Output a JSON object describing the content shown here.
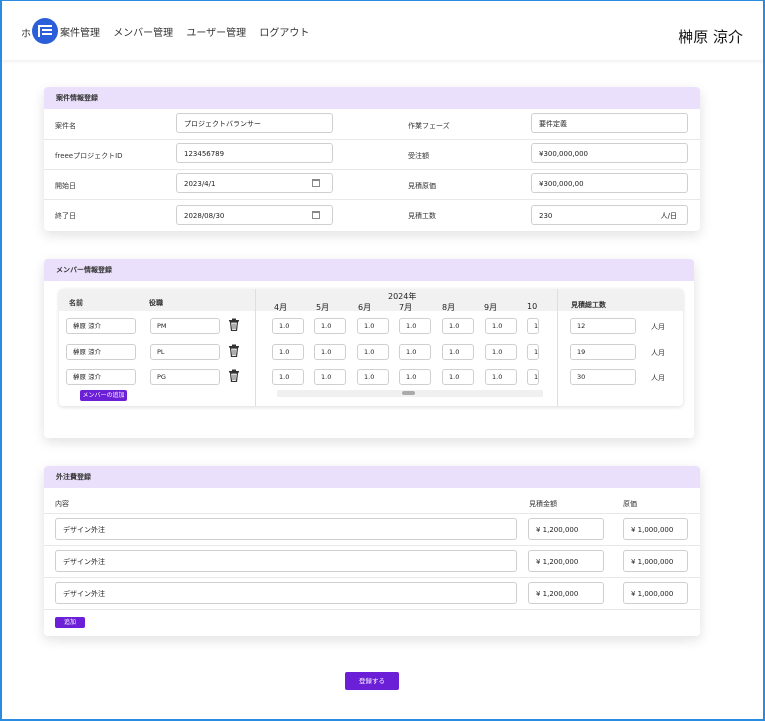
{
  "header": {
    "home_fragment": "ホ",
    "nav": [
      "案件管理",
      "メンバー管理",
      "ユーザー管理",
      "ログアウト"
    ],
    "user_name": "榊原 涼介",
    "logo_icon": "app-logo-icon"
  },
  "project": {
    "title": "案件情報登録",
    "rows": [
      {
        "label_left": "案件名",
        "value_left": "プロジェクトバランサー",
        "label_right": "作業フェーズ",
        "value_right": "要件定義"
      },
      {
        "label_left": "freeeプロジェクトID",
        "value_left": "123456789",
        "label_right": "受注額",
        "value_right": "¥300,000,000"
      },
      {
        "label_left": "開始日",
        "value_left": "2023/4/1",
        "label_right": "見積原価",
        "value_right": "¥300,000,00"
      },
      {
        "label_left": "終了日",
        "value_left": "2028/08/30",
        "label_right": "見積工数",
        "value_right": "230",
        "unit_right": "人/日"
      }
    ]
  },
  "members": {
    "title": "メンバー情報登録",
    "col_name": "名前",
    "col_role": "役職",
    "year": "2024年",
    "months": [
      "4月",
      "5月",
      "6月",
      "7月",
      "8月",
      "9月",
      "10"
    ],
    "col_total": "見積総工数",
    "unit": "人月",
    "add_label": "メンバーの追加",
    "rows": [
      {
        "name": "榊原 涼介",
        "role": "PM",
        "values": [
          "1.0",
          "1.0",
          "1.0",
          "1.0",
          "1.0",
          "1.0",
          "1"
        ],
        "total": "12"
      },
      {
        "name": "榊原 涼介",
        "role": "PL",
        "values": [
          "1.0",
          "1.0",
          "1.0",
          "1.0",
          "1.0",
          "1.0",
          "1"
        ],
        "total": "19"
      },
      {
        "name": "榊原 涼介",
        "role": "PG",
        "values": [
          "1.0",
          "1.0",
          "1.0",
          "1.0",
          "1.0",
          "1.0",
          "1"
        ],
        "total": "30"
      }
    ]
  },
  "outsource": {
    "title": "外注費登録",
    "col_content": "内容",
    "col_estimate": "見積金額",
    "col_cost": "原価",
    "add_label": "追加",
    "rows": [
      {
        "content": "デザイン外注",
        "estimate": "¥ 1,200,000",
        "cost": "¥ 1,000,000"
      },
      {
        "content": "デザイン外注",
        "estimate": "¥ 1,200,000",
        "cost": "¥ 1,000,000"
      },
      {
        "content": "デザイン外注",
        "estimate": "¥ 1,200,000",
        "cost": "¥ 1,000,000"
      }
    ]
  },
  "submit_label": "登録する",
  "colors": {
    "accent": "#6b1fd6",
    "section_header": "#ebe0fb",
    "logo": "#2b5fd9"
  }
}
